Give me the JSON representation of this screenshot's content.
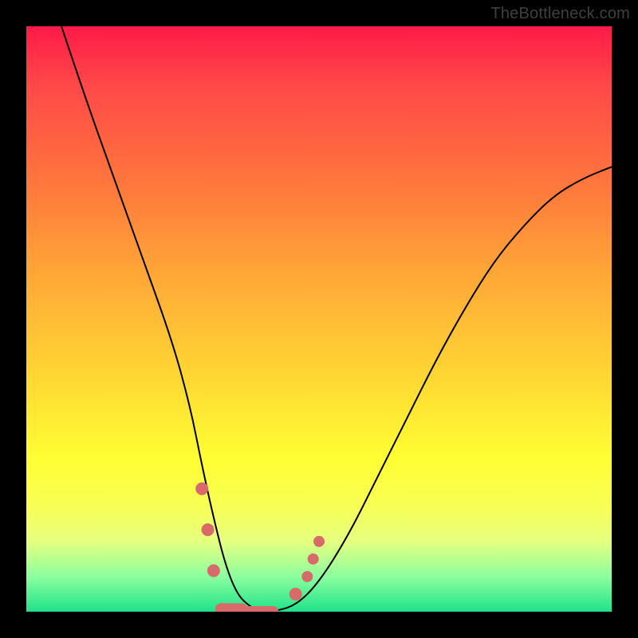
{
  "watermark": "TheBottleneck.com",
  "chart_data": {
    "type": "line",
    "title": "",
    "xlabel": "",
    "ylabel": "",
    "xlim": [
      0,
      100
    ],
    "ylim": [
      0,
      100
    ],
    "series": [
      {
        "name": "curve",
        "x": [
          6,
          10,
          15,
          20,
          25,
          28,
          30,
          32,
          34,
          36,
          38,
          40,
          42,
          46,
          50,
          55,
          60,
          65,
          70,
          75,
          80,
          85,
          90,
          95,
          100
        ],
        "y": [
          100,
          88,
          74,
          60,
          46,
          35,
          25,
          16,
          8,
          3,
          1,
          0,
          0,
          1,
          5,
          13,
          23,
          33,
          43,
          52,
          60,
          66,
          71,
          74,
          76
        ]
      }
    ],
    "markers": [
      {
        "x": 30,
        "y": 21,
        "r": 8
      },
      {
        "x": 31,
        "y": 14,
        "r": 8
      },
      {
        "x": 32,
        "y": 7,
        "r": 8
      },
      {
        "x": 35,
        "y": 0.5,
        "r": 7,
        "type": "pill",
        "w": 40
      },
      {
        "x": 40,
        "y": 0,
        "r": 7,
        "type": "pill",
        "w": 45
      },
      {
        "x": 46,
        "y": 3,
        "r": 8
      },
      {
        "x": 48,
        "y": 6,
        "r": 7
      },
      {
        "x": 49,
        "y": 9,
        "r": 7
      },
      {
        "x": 50,
        "y": 12,
        "r": 7
      }
    ],
    "colors": {
      "gradient_top": "#ff1a48",
      "gradient_bottom": "#1fe28a",
      "curve": "#000000",
      "markers": "#d86a6a"
    }
  }
}
